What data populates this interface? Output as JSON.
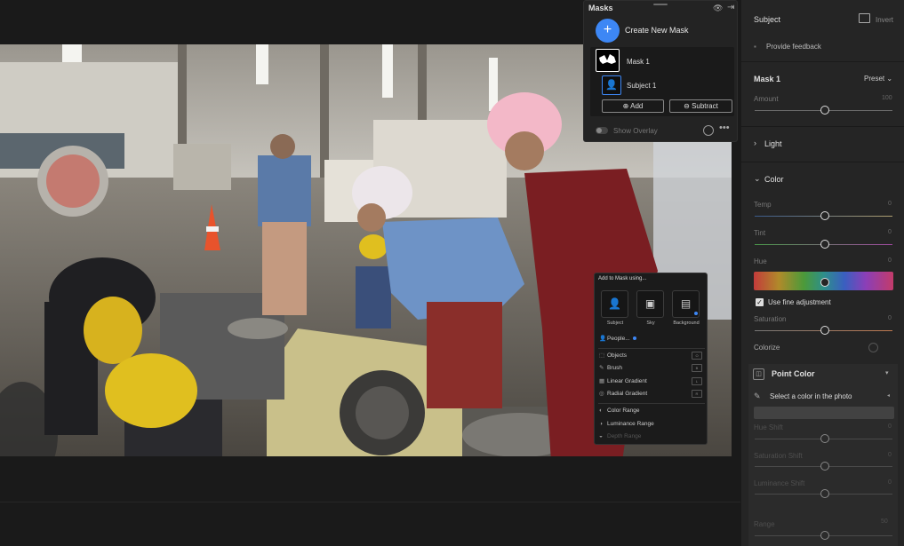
{
  "masks_panel": {
    "title": "Masks",
    "create_label": "Create New Mask",
    "create_icon": "+",
    "mask1_label": "Mask 1",
    "subject_label": "Subject 1",
    "subject_icon": "👤",
    "add_label": "Add",
    "add_icon": "⊕",
    "subtract_label": "Subtract",
    "subtract_icon": "⊖",
    "show_overlay_label": "Show Overlay",
    "eye_icon": "👁",
    "exit_icon": "⇥",
    "more_icon": "•••"
  },
  "add_popup": {
    "title": "Add to Mask using...",
    "tiles": [
      {
        "label": "Subject",
        "icon": "👤"
      },
      {
        "label": "Sky",
        "icon": "▣"
      },
      {
        "label": "Background",
        "icon": "▤"
      }
    ],
    "people_label": "People...",
    "items": [
      {
        "label": "Objects",
        "icon": "⬚",
        "key": "O"
      },
      {
        "label": "Brush",
        "icon": "✎",
        "key": "B"
      },
      {
        "label": "Linear Gradient",
        "icon": "▦",
        "key": "L"
      },
      {
        "label": "Radial Gradient",
        "icon": "◎",
        "key": "R"
      }
    ],
    "items2": [
      {
        "label": "Color Range",
        "icon": "◐"
      },
      {
        "label": "Luminance Range",
        "icon": "◑"
      },
      {
        "label": "Depth Range",
        "icon": "◒"
      }
    ]
  },
  "right_panel": {
    "subject_title": "Subject",
    "invert_label": "Invert",
    "feedback_label": "Provide feedback",
    "mask1_title": "Mask 1",
    "preset_label": "Preset",
    "amount_label": "Amount",
    "amount_value": "100",
    "light_label": "Light",
    "color_label": "Color",
    "temp_label": "Temp",
    "temp_value": "0",
    "tint_label": "Tint",
    "tint_value": "0",
    "hue_label": "Hue",
    "hue_value": "0",
    "fine_adjust_label": "Use fine adjustment",
    "saturation_label": "Saturation",
    "saturation_value": "0",
    "colorize_label": "Colorize",
    "point_color_label": "Point Color",
    "select_color_label": "Select a color in the photo",
    "hue_shift_label": "Hue Shift",
    "hue_shift_value": "0",
    "sat_shift_label": "Saturation Shift",
    "sat_shift_value": "0",
    "lum_shift_label": "Luminance Shift",
    "lum_shift_value": "0",
    "range_label": "Range",
    "range_value": "50"
  },
  "colors": {
    "accent": "#3d87f5",
    "panel_bg": "#252525",
    "canvas_bg": "#1a1a1a"
  }
}
